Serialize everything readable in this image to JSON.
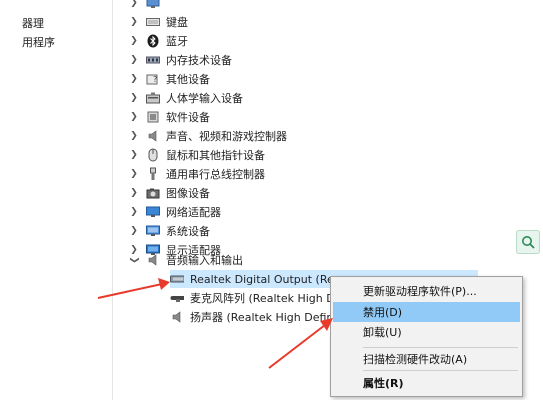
{
  "left_nav": {
    "items": [
      "器理",
      "用程序"
    ]
  },
  "tree": {
    "categories": [
      {
        "label": "键盘",
        "icon": "keyboard-icon"
      },
      {
        "label": "蓝牙",
        "icon": "bluetooth-icon"
      },
      {
        "label": "内存技术设备",
        "icon": "memory-device-icon"
      },
      {
        "label": "其他设备",
        "icon": "other-device-icon"
      },
      {
        "label": "人体学输入设备",
        "icon": "hid-icon"
      },
      {
        "label": "软件设备",
        "icon": "software-device-icon"
      },
      {
        "label": "声音、视频和游戏控制器",
        "icon": "speaker-icon"
      },
      {
        "label": "鼠标和其他指针设备",
        "icon": "mouse-icon"
      },
      {
        "label": "通用串行总线控制器",
        "icon": "usb-icon"
      },
      {
        "label": "图像设备",
        "icon": "camera-icon"
      },
      {
        "label": "网络适配器",
        "icon": "network-adapter-icon"
      },
      {
        "label": "系统设备",
        "icon": "system-device-icon"
      },
      {
        "label": "显示适配器",
        "icon": "display-adapter-icon"
      }
    ],
    "expanded": {
      "label": "音频输入和输出",
      "icon": "speaker-icon",
      "children": [
        {
          "label": "Realtek Digital Output (Re",
          "icon": "digital-output-icon",
          "selected": true
        },
        {
          "label": "麦克风阵列 (Realtek High D",
          "icon": "microphone-icon",
          "selected": false
        },
        {
          "label": "扬声器 (Realtek High Defin",
          "icon": "speaker-icon",
          "selected": false
        }
      ]
    }
  },
  "context_menu": {
    "items": [
      {
        "label": "更新驱动程序软件(P)...",
        "hover": false,
        "bold": false
      },
      {
        "label": "禁用(D)",
        "hover": true,
        "bold": false
      },
      {
        "label": "卸载(U)",
        "hover": false,
        "bold": false
      },
      {
        "label": "扫描检测硬件改动(A)",
        "hover": false,
        "bold": false
      },
      {
        "label": "属性(R)",
        "hover": false,
        "bold": true
      }
    ]
  },
  "annotation_color": "#e8392a",
  "selection_color": "#cce8ff",
  "menu_hover_color": "#91c9f7"
}
